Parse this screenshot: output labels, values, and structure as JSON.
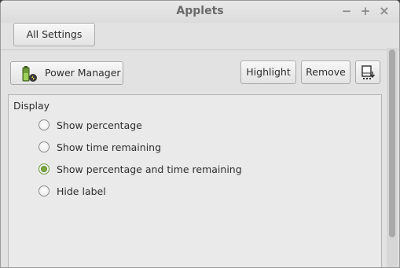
{
  "window": {
    "title": "Applets",
    "minimize_glyph": "−",
    "maximize_glyph": "+",
    "close_glyph": "×"
  },
  "toolbar": {
    "all_settings_label": "All Settings"
  },
  "applet_bar": {
    "applet_name": "Power Manager",
    "highlight_label": "Highlight",
    "remove_label": "Remove"
  },
  "display": {
    "section_label": "Display",
    "options": [
      {
        "label": "Show percentage",
        "checked": false
      },
      {
        "label": "Show time remaining",
        "checked": false
      },
      {
        "label": "Show percentage and time remaining",
        "checked": true
      },
      {
        "label": "Hide label",
        "checked": false
      }
    ]
  },
  "colors": {
    "accent": "#7aa83c"
  }
}
